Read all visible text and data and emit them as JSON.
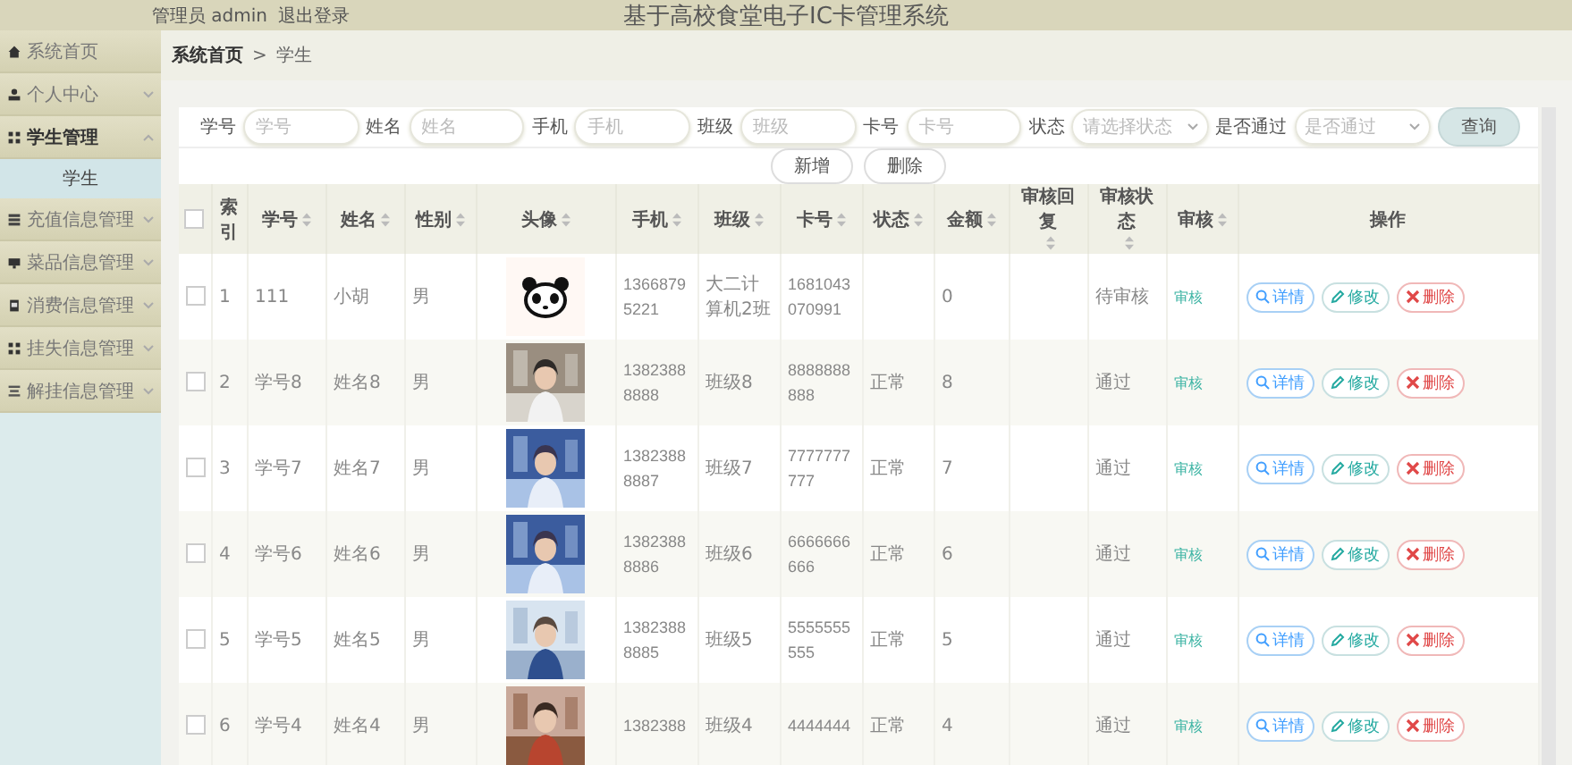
{
  "header": {
    "account": "管理员 admin",
    "logout": "退出登录",
    "title": "基于高校食堂电子IC卡管理系统"
  },
  "sidebar": {
    "items": [
      {
        "label": "系统首页",
        "expandable": false,
        "expanded": false,
        "selected": false
      },
      {
        "label": "个人中心",
        "expandable": true,
        "expanded": false,
        "selected": false
      },
      {
        "label": "学生管理",
        "expandable": true,
        "expanded": true,
        "selected": true,
        "children": [
          {
            "label": "学生",
            "selected": true
          }
        ]
      },
      {
        "label": "充值信息管理",
        "expandable": true,
        "expanded": false,
        "selected": false
      },
      {
        "label": "菜品信息管理",
        "expandable": true,
        "expanded": false,
        "selected": false
      },
      {
        "label": "消费信息管理",
        "expandable": true,
        "expanded": false,
        "selected": false
      },
      {
        "label": "挂失信息管理",
        "expandable": true,
        "expanded": false,
        "selected": false
      },
      {
        "label": "解挂信息管理",
        "expandable": true,
        "expanded": false,
        "selected": false
      }
    ]
  },
  "breadcrumb": {
    "items": [
      "系统首页",
      "学生"
    ],
    "separator": ">"
  },
  "search": {
    "fields": [
      {
        "label": "学号",
        "placeholder": "学号",
        "kind": "input"
      },
      {
        "label": "姓名",
        "placeholder": "姓名",
        "kind": "input"
      },
      {
        "label": "手机",
        "placeholder": "手机",
        "kind": "input"
      },
      {
        "label": "班级",
        "placeholder": "班级",
        "kind": "input"
      },
      {
        "label": "卡号",
        "placeholder": "卡号",
        "kind": "input"
      },
      {
        "label": "状态",
        "placeholder": "请选择状态",
        "kind": "select"
      },
      {
        "label": "是否通过",
        "placeholder": "是否通过",
        "kind": "select"
      }
    ],
    "button": "查询"
  },
  "actions": [
    "新增",
    "删除"
  ],
  "table": {
    "select_all": {
      "checked": false
    },
    "columns": [
      {
        "label": "索引",
        "sortable": false
      },
      {
        "label": "学号",
        "sortable": true
      },
      {
        "label": "姓名",
        "sortable": true
      },
      {
        "label": "性别",
        "sortable": true
      },
      {
        "label": "头像",
        "sortable": true
      },
      {
        "label": "手机",
        "sortable": true
      },
      {
        "label": "班级",
        "sortable": true
      },
      {
        "label": "卡号",
        "sortable": true
      },
      {
        "label": "状态",
        "sortable": true
      },
      {
        "label": "金额",
        "sortable": true
      },
      {
        "label": "审核回复",
        "sortable": true
      },
      {
        "label": "审核状态",
        "sortable": true
      },
      {
        "label": "审核",
        "sortable": true
      },
      {
        "label": "操作",
        "sortable": false
      }
    ],
    "rows": [
      {
        "checked": false,
        "index": "1",
        "id": "111",
        "name": "小胡",
        "gender": "男",
        "avatar": {
          "kind": "icon"
        },
        "phone": "1366879 5221",
        "class": "大二计算机2班",
        "card": "1681043 070991",
        "status": "",
        "amount": "0",
        "review_reply": "",
        "review_status": "待审核",
        "review": "审核",
        "buttons": [
          "详情",
          "修改",
          "删除"
        ]
      },
      {
        "checked": false,
        "index": "2",
        "id": "学号8",
        "name": "姓名8",
        "gender": "男",
        "phone": "1382388 8888",
        "class": "班级8",
        "card": "8888888 888",
        "status": "正常",
        "amount": "8",
        "review_reply": "",
        "review_status": "通过",
        "review": "审核",
        "buttons": [
          "详情",
          "修改",
          "删除"
        ]
      },
      {
        "checked": false,
        "index": "3",
        "id": "学号7",
        "name": "姓名7",
        "gender": "男",
        "phone": "1382388 8887",
        "class": "班级7",
        "card": "7777777 777",
        "status": "正常",
        "amount": "7",
        "review_reply": "",
        "review_status": "通过",
        "review": "审核",
        "buttons": [
          "详情",
          "修改",
          "删除"
        ]
      },
      {
        "checked": false,
        "index": "4",
        "id": "学号6",
        "name": "姓名6",
        "gender": "男",
        "phone": "1382388 8886",
        "class": "班级6",
        "card": "6666666 666",
        "status": "正常",
        "amount": "6",
        "review_reply": "",
        "review_status": "通过",
        "review": "审核",
        "buttons": [
          "详情",
          "修改",
          "删除"
        ]
      },
      {
        "checked": false,
        "index": "5",
        "id": "学号5",
        "name": "姓名5",
        "gender": "男",
        "phone": "1382388 8885",
        "class": "班级5",
        "card": "5555555 555",
        "status": "正常",
        "amount": "5",
        "review_reply": "",
        "review_status": "通过",
        "review": "审核",
        "buttons": [
          "详情",
          "修改",
          "删除"
        ]
      },
      {
        "checked": false,
        "index": "6",
        "id": "学号4",
        "name": "姓名4",
        "gender": "男",
        "phone": "1382388",
        "class": "班级4",
        "card": "4444444",
        "status": "正常",
        "amount": "4",
        "review_reply": "",
        "review_status": "通过",
        "review": "审核",
        "buttons": [
          "详情",
          "修改",
          "删除"
        ]
      }
    ]
  }
}
